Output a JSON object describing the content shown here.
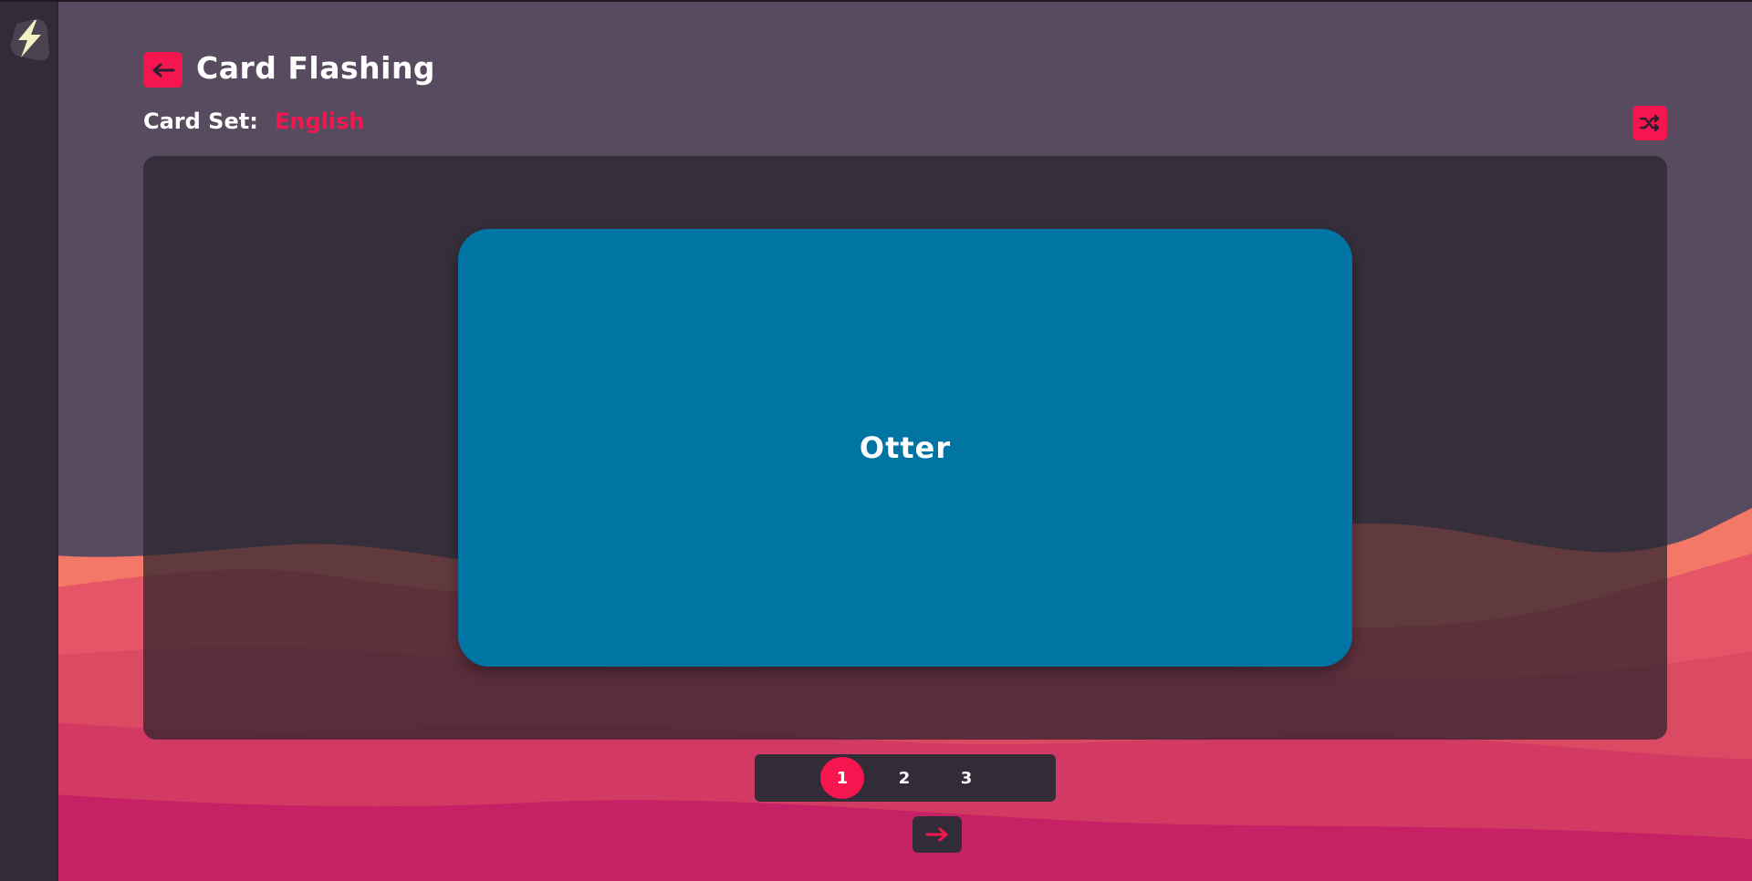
{
  "header": {
    "title": "Card Flashing",
    "back_icon": "arrow-left-icon"
  },
  "card_set": {
    "label": "Card Set:",
    "value": "English"
  },
  "toolbar": {
    "shuffle_icon": "shuffle-icon"
  },
  "card": {
    "text": "Otter"
  },
  "pagination": {
    "pages": [
      "1",
      "2",
      "3"
    ],
    "active_page": "1"
  },
  "navigation": {
    "next_icon": "arrow-right-icon"
  },
  "colors": {
    "accent": "#f5154f",
    "background": "#584b60",
    "panel": "#322c38",
    "card": "#0074a3",
    "logo_bolt": "#f3f0c2"
  }
}
